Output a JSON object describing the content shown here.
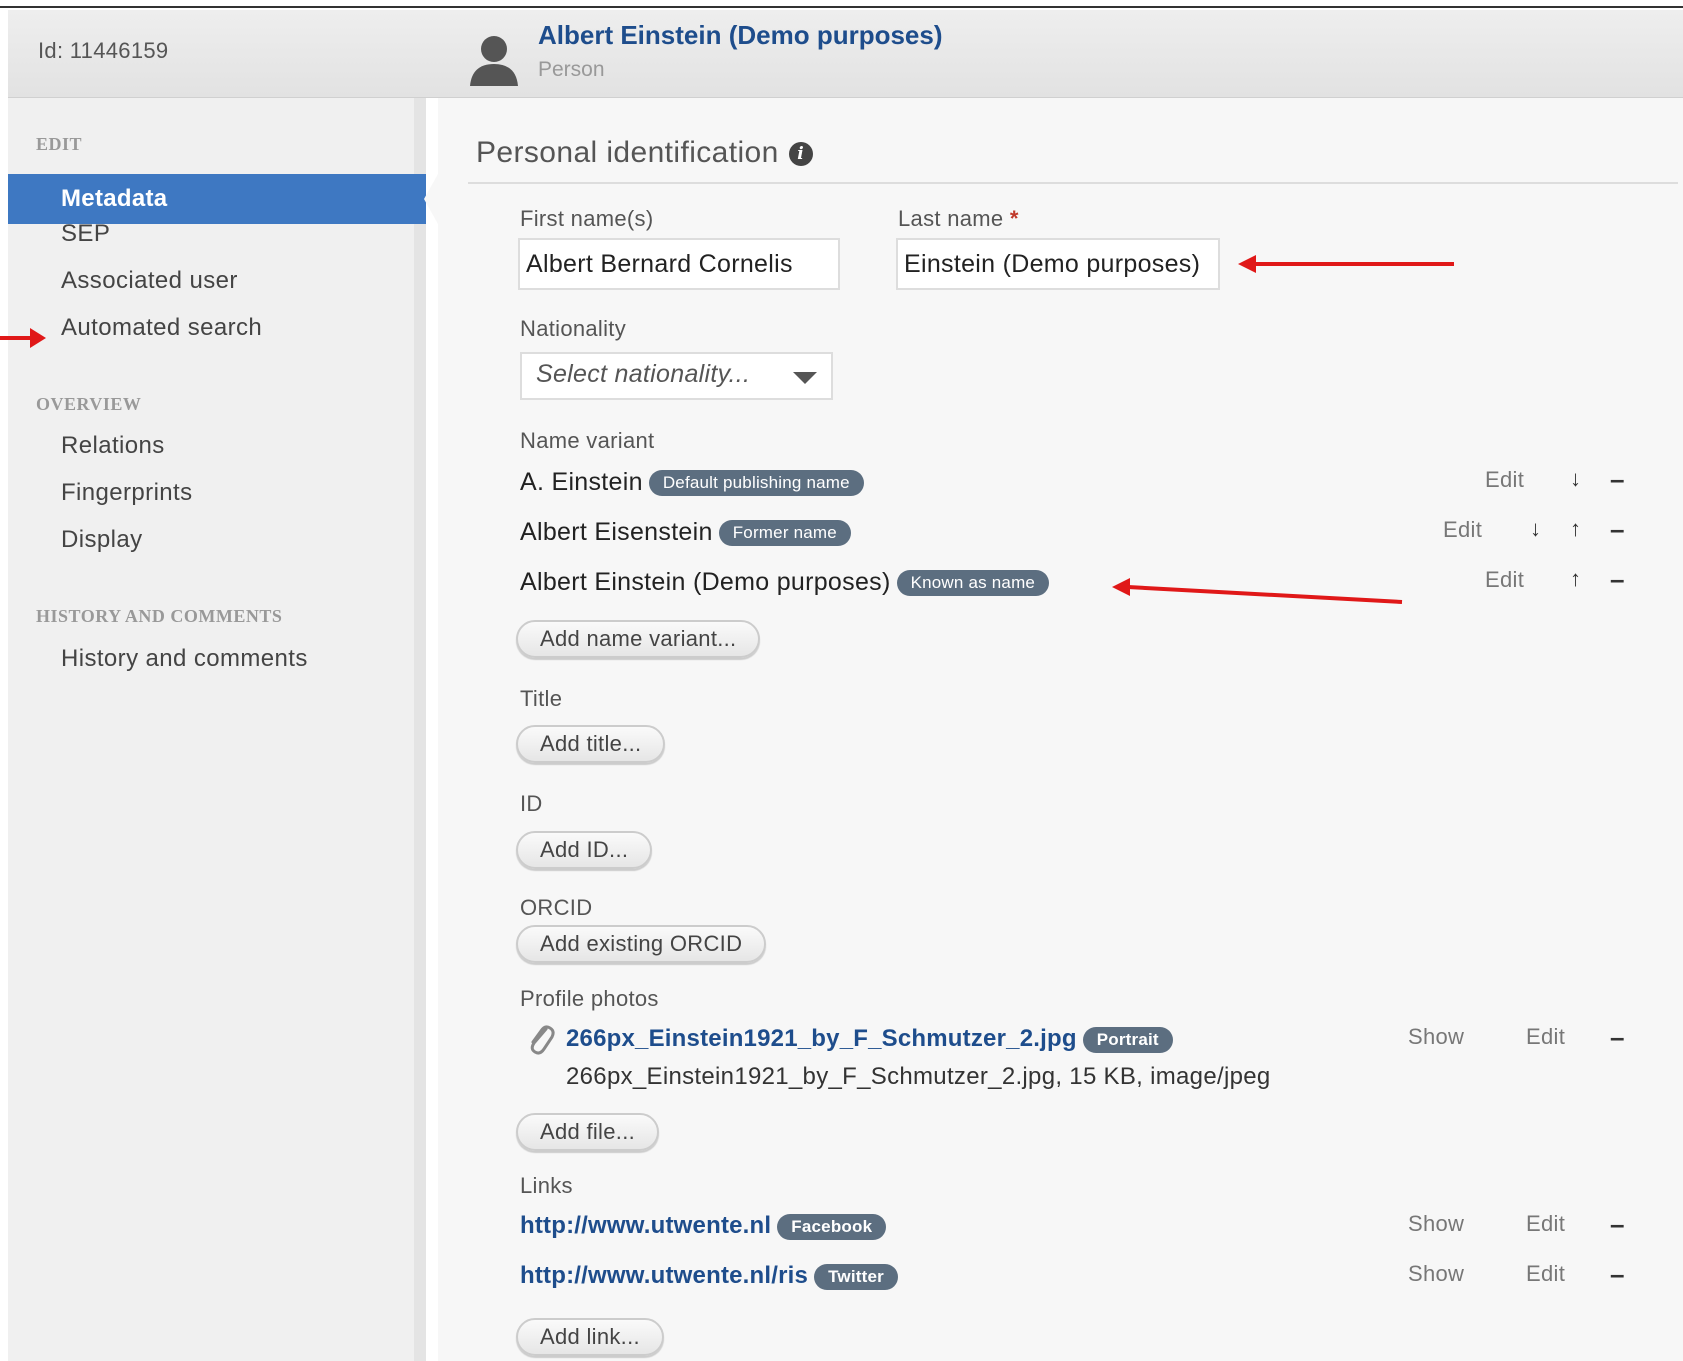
{
  "header": {
    "id_text": "Id: 11446159",
    "title": "Albert Einstein (Demo purposes)",
    "subtitle": "Person"
  },
  "sidebar": {
    "sections": [
      {
        "label": "EDIT",
        "items": [
          "Metadata",
          "SEP",
          "Associated user",
          "Automated search"
        ]
      },
      {
        "label": "OVERVIEW",
        "items": [
          "Relations",
          "Fingerprints",
          "Display"
        ]
      },
      {
        "label": "HISTORY AND COMMENTS",
        "items": [
          "History and comments"
        ]
      }
    ],
    "active_item": "Metadata"
  },
  "main": {
    "section_title": "Personal identification",
    "first_name": {
      "label": "First name(s)",
      "value": "Albert Bernard Cornelis"
    },
    "last_name": {
      "label": "Last name",
      "required_mark": "*",
      "value": "Einstein (Demo purposes)"
    },
    "nationality": {
      "label": "Nationality",
      "placeholder": "Select nationality..."
    },
    "name_variant": {
      "label": "Name variant",
      "rows": [
        {
          "name": "A. Einstein",
          "badge": "Default publishing name",
          "edit": "Edit"
        },
        {
          "name": "Albert Eisenstein",
          "badge": "Former name",
          "edit": "Edit"
        },
        {
          "name": "Albert Einstein (Demo purposes)",
          "badge": "Known as name",
          "edit": "Edit"
        }
      ],
      "add_button": "Add name variant..."
    },
    "title_field": {
      "label": "Title",
      "add_button": "Add title..."
    },
    "id_field": {
      "label": "ID",
      "add_button": "Add ID..."
    },
    "orcid": {
      "label": "ORCID",
      "add_button": "Add existing ORCID"
    },
    "profile_photos": {
      "label": "Profile photos",
      "file_name": "266px_Einstein1921_by_F_Schmutzer_2.jpg",
      "badge": "Portrait",
      "meta": "266px_Einstein1921_by_F_Schmutzer_2.jpg, 15 KB, image/jpeg",
      "show": "Show",
      "edit": "Edit",
      "add_button": "Add file..."
    },
    "links": {
      "label": "Links",
      "rows": [
        {
          "url": "http://www.utwente.nl",
          "badge": "Facebook",
          "show": "Show",
          "edit": "Edit"
        },
        {
          "url": "http://www.utwente.nl/ris",
          "badge": "Twitter",
          "show": "Show",
          "edit": "Edit"
        }
      ],
      "add_button": "Add link..."
    },
    "icons": {
      "down": "↓",
      "up": "↑",
      "remove": "–"
    }
  },
  "colors": {
    "accent": "#3e78c2",
    "link": "#1e4d8c",
    "badge": "#5c6e80",
    "annotation": "#e01818"
  }
}
